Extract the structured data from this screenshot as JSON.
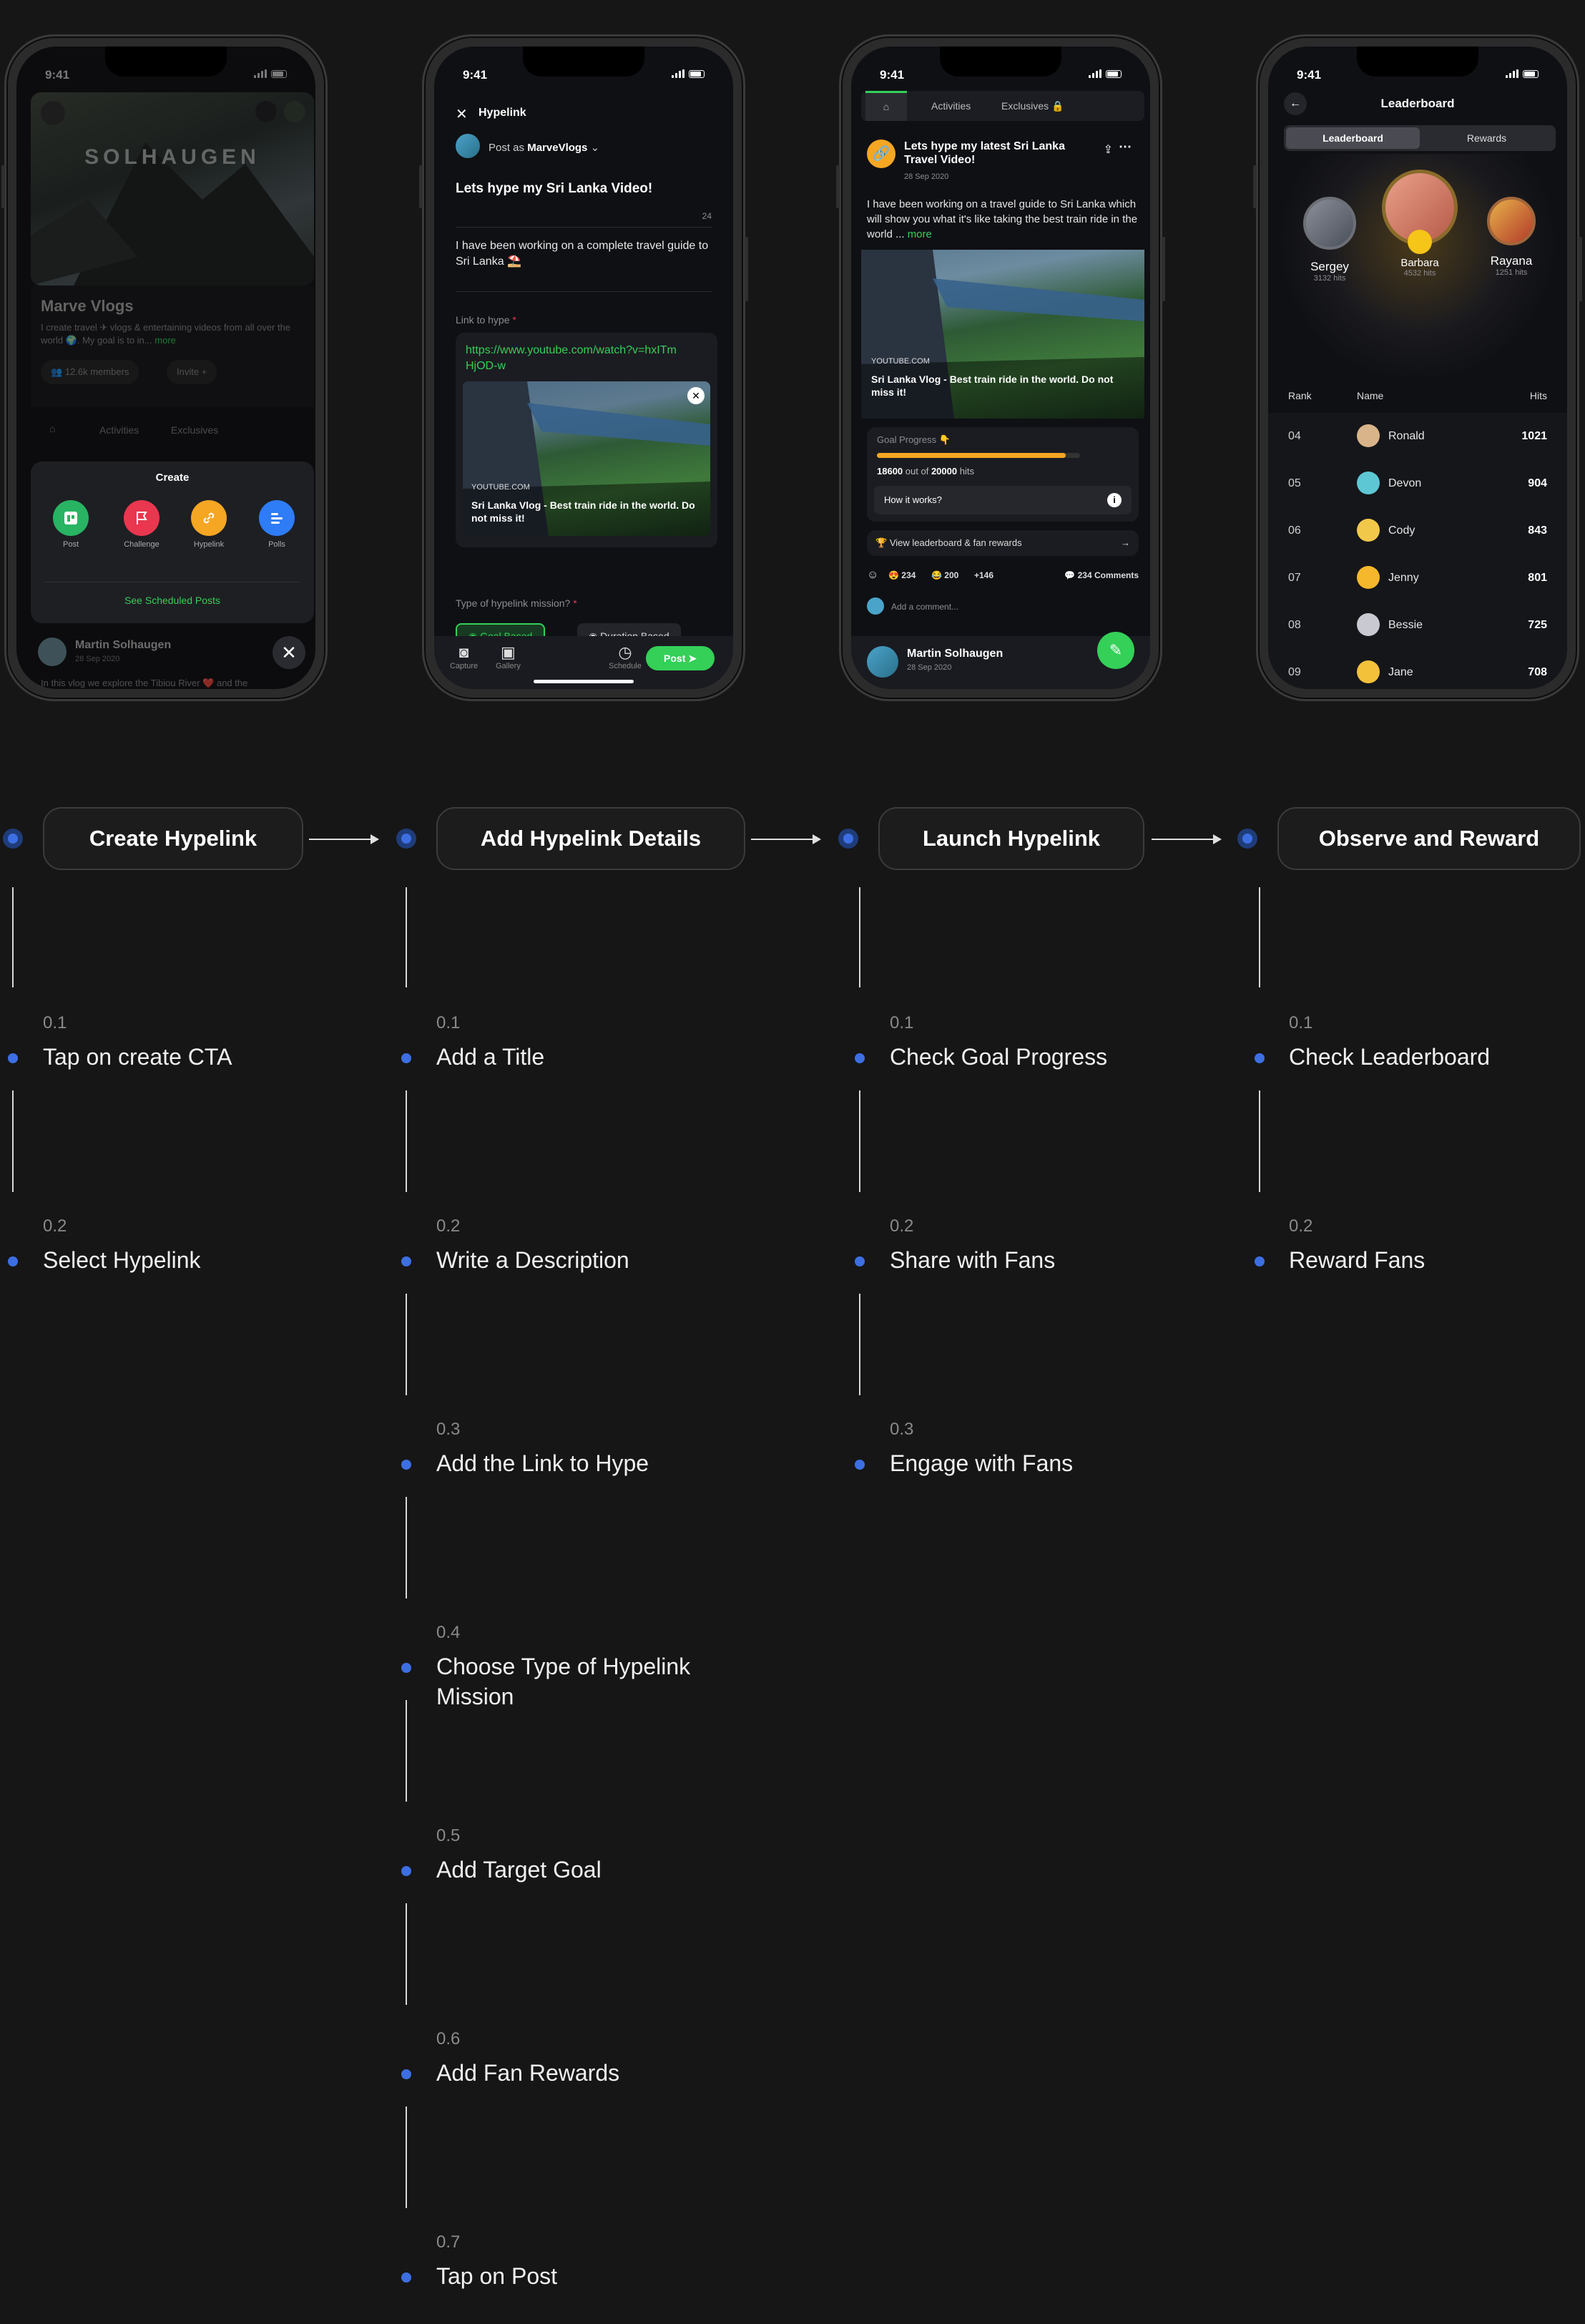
{
  "phone1": {
    "time": "9:41",
    "cover_title": "SOLHAUGEN",
    "channel_name": "Marve Vlogs",
    "channel_desc": "I create travel ✈ vlogs & entertaining videos from all over the world 🌍. My goal is to in...",
    "more": "more",
    "members": "12.6k members",
    "invite": "Invite +",
    "tabs": [
      "Activities",
      "Exclusives"
    ],
    "sheet_title": "Create",
    "create_items": [
      "Post",
      "Challenge",
      "Hypelink",
      "Polls"
    ],
    "scheduled_link": "See Scheduled Posts",
    "author": "Martin Solhaugen",
    "date": "28 Sep 2020",
    "snippet": "In this vlog we explore the Tibiou River ❤️ and the"
  },
  "phone2": {
    "time": "9:41",
    "header": "Hypelink",
    "post_as_prefix": "Post as",
    "post_as_name": "MarveVlogs",
    "title": "Lets hype my Sri Lanka Video!",
    "char_count": "24",
    "description": "I have been working on a complete travel guide to Sri Lanka ⛱️",
    "link_label": "Link to hype",
    "link_url": "https://www.youtube.com/watch?v=hxITmHjOD-w",
    "preview_source": "YOUTUBE.COM",
    "preview_title": "Sri Lanka Vlog - Best train ride in the world. Do not miss it!",
    "mission_label": "Type of hypelink mission?",
    "mission_options": [
      "Goal Based",
      "Duration Based"
    ],
    "toolbar": [
      "Capture",
      "Gallery",
      "Schedule"
    ],
    "post_btn": "Post"
  },
  "phone3": {
    "time": "9:41",
    "tabs": [
      "Activities",
      "Exclusives"
    ],
    "post_title": "Lets hype my latest Sri Lanka Travel Video!",
    "post_date": "28 Sep 2020",
    "body": "I have been working on a travel guide to Sri Lanka which will show you what it's like taking the best train ride in the world ...",
    "more": "more",
    "preview_source": "YOUTUBE.COM",
    "preview_title": "Sri Lanka Vlog - Best train ride in the world. Do not miss it!",
    "goal_label": "Goal Progress",
    "goal_current": "18600",
    "goal_mid": "out of",
    "goal_target": "20000",
    "goal_unit": "hits",
    "goal_fraction": 0.93,
    "how_it_works": "How it works?",
    "leaderboard_link": "View leaderboard & fan rewards",
    "reactions": [
      "234",
      "200",
      "+146"
    ],
    "comments": "234 Comments",
    "comment_placeholder": "Add a comment...",
    "author": "Martin Solhaugen",
    "author_date": "28 Sep 2020"
  },
  "phone4": {
    "time": "9:41",
    "title": "Leaderboard",
    "segments": [
      "Leaderboard",
      "Rewards"
    ],
    "podium": [
      {
        "name": "Sergey",
        "hits": "3132 hits"
      },
      {
        "name": "Barbara",
        "hits": "4532 hits"
      },
      {
        "name": "Rayana",
        "hits": "1251 hits"
      }
    ],
    "columns": [
      "Rank",
      "Name",
      "Hits"
    ],
    "rows": [
      {
        "rank": "04",
        "name": "Ronald",
        "hits": "1021"
      },
      {
        "rank": "05",
        "name": "Devon",
        "hits": "904"
      },
      {
        "rank": "06",
        "name": "Cody",
        "hits": "843"
      },
      {
        "rank": "07",
        "name": "Jenny",
        "hits": "801"
      },
      {
        "rank": "08",
        "name": "Bessie",
        "hits": "725"
      },
      {
        "rank": "09",
        "name": "Jane",
        "hits": "708"
      }
    ]
  },
  "flow": {
    "steps": [
      {
        "title": "Create Hypelink",
        "items": [
          {
            "num": "0.1",
            "text": "Tap on create CTA"
          },
          {
            "num": "0.2",
            "text": "Select Hypelink"
          }
        ]
      },
      {
        "title": "Add Hypelink Details",
        "items": [
          {
            "num": "0.1",
            "text": "Add a Title"
          },
          {
            "num": "0.2",
            "text": "Write a Description"
          },
          {
            "num": "0.3",
            "text": "Add the Link to Hype"
          },
          {
            "num": "0.4",
            "text": "Choose Type of Hypelink Mission"
          },
          {
            "num": "0.5",
            "text": "Add Target Goal"
          },
          {
            "num": "0.6",
            "text": "Add Fan Rewards"
          },
          {
            "num": "0.7",
            "text": "Tap on Post"
          }
        ]
      },
      {
        "title": "Launch Hypelink",
        "items": [
          {
            "num": "0.1",
            "text": "Check Goal Progress"
          },
          {
            "num": "0.2",
            "text": "Share with Fans"
          },
          {
            "num": "0.3",
            "text": "Engage with Fans"
          }
        ]
      },
      {
        "title": "Observe and Reward",
        "items": [
          {
            "num": "0.1",
            "text": "Check Leaderboard"
          },
          {
            "num": "0.2",
            "text": "Reward Fans"
          }
        ]
      }
    ]
  },
  "colors": {
    "background": "#161616",
    "accent_blue": "#3d6fe3",
    "green": "#34d058",
    "orange": "#f5a623"
  }
}
